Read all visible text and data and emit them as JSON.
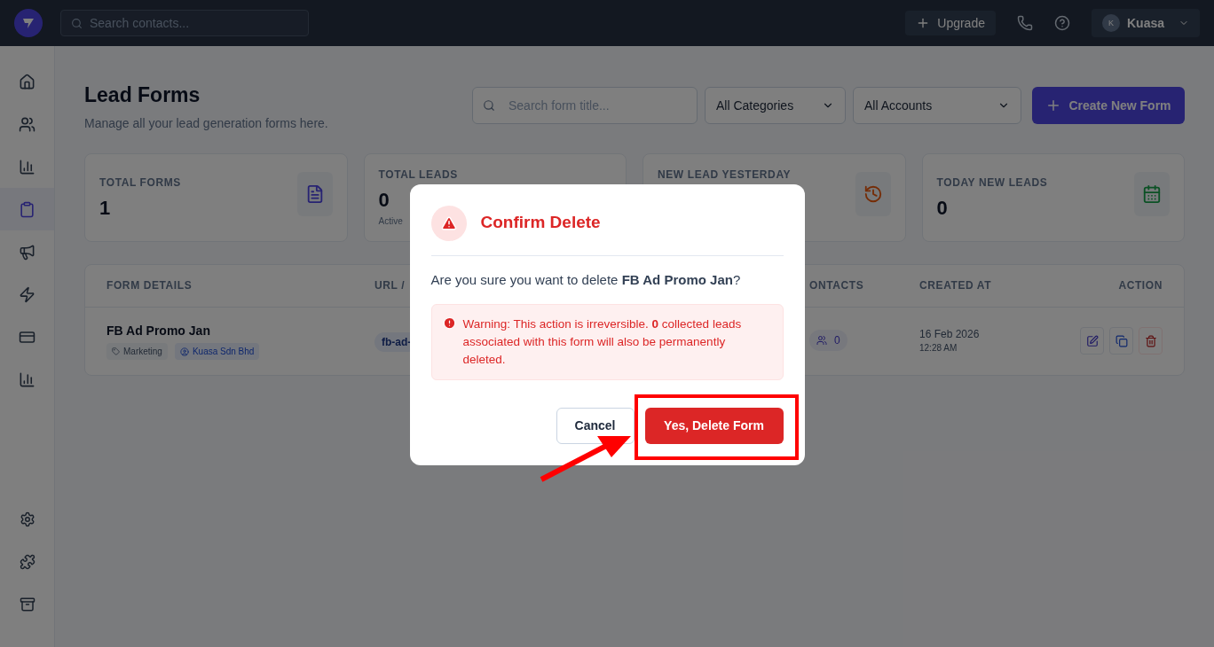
{
  "topbar": {
    "search_placeholder": "Search contacts...",
    "upgrade": "Upgrade",
    "user_initial": "K",
    "user_name": "Kuasa"
  },
  "sidebar": {
    "items": [
      {
        "selected": false
      },
      {
        "selected": false
      },
      {
        "selected": false
      },
      {
        "selected": true
      },
      {
        "selected": false
      },
      {
        "selected": false
      },
      {
        "selected": false
      },
      {
        "selected": false
      }
    ]
  },
  "header": {
    "title": "Lead Forms",
    "subtitle": "Manage all your lead generation forms here.",
    "search_placeholder": "Search form title...",
    "category": "All Categories",
    "account": "All Accounts",
    "create": "Create New Form"
  },
  "stats": [
    {
      "label": "TOTAL FORMS",
      "value": "1"
    },
    {
      "label": "TOTAL LEADS",
      "value": "0",
      "note": "Active"
    },
    {
      "label": "NEW LEAD YESTERDAY"
    },
    {
      "label": "TODAY NEW LEADS",
      "value": "0"
    }
  ],
  "table": {
    "columns": [
      "FORM DETAILS",
      "URL /",
      "ONTACTS",
      "CREATED AT",
      "ACTION"
    ],
    "rows": [
      {
        "name": "FB Ad Promo Jan",
        "category": "Marketing",
        "account": "Kuasa Sdn Bhd",
        "url": "fb-ad-",
        "contacts": "0",
        "date": "16 Feb 2026",
        "time": "12:28 AM"
      }
    ]
  },
  "dialog": {
    "title": "Confirm Delete",
    "question": "Are you sure you want to delete **FB Ad Promo Jan**?",
    "warning": "Warning: This action is irreversible. **0** collected leads associated with this form will also be permanently deleted.",
    "cancel": "Cancel",
    "confirm": "Yes, Delete Form"
  }
}
